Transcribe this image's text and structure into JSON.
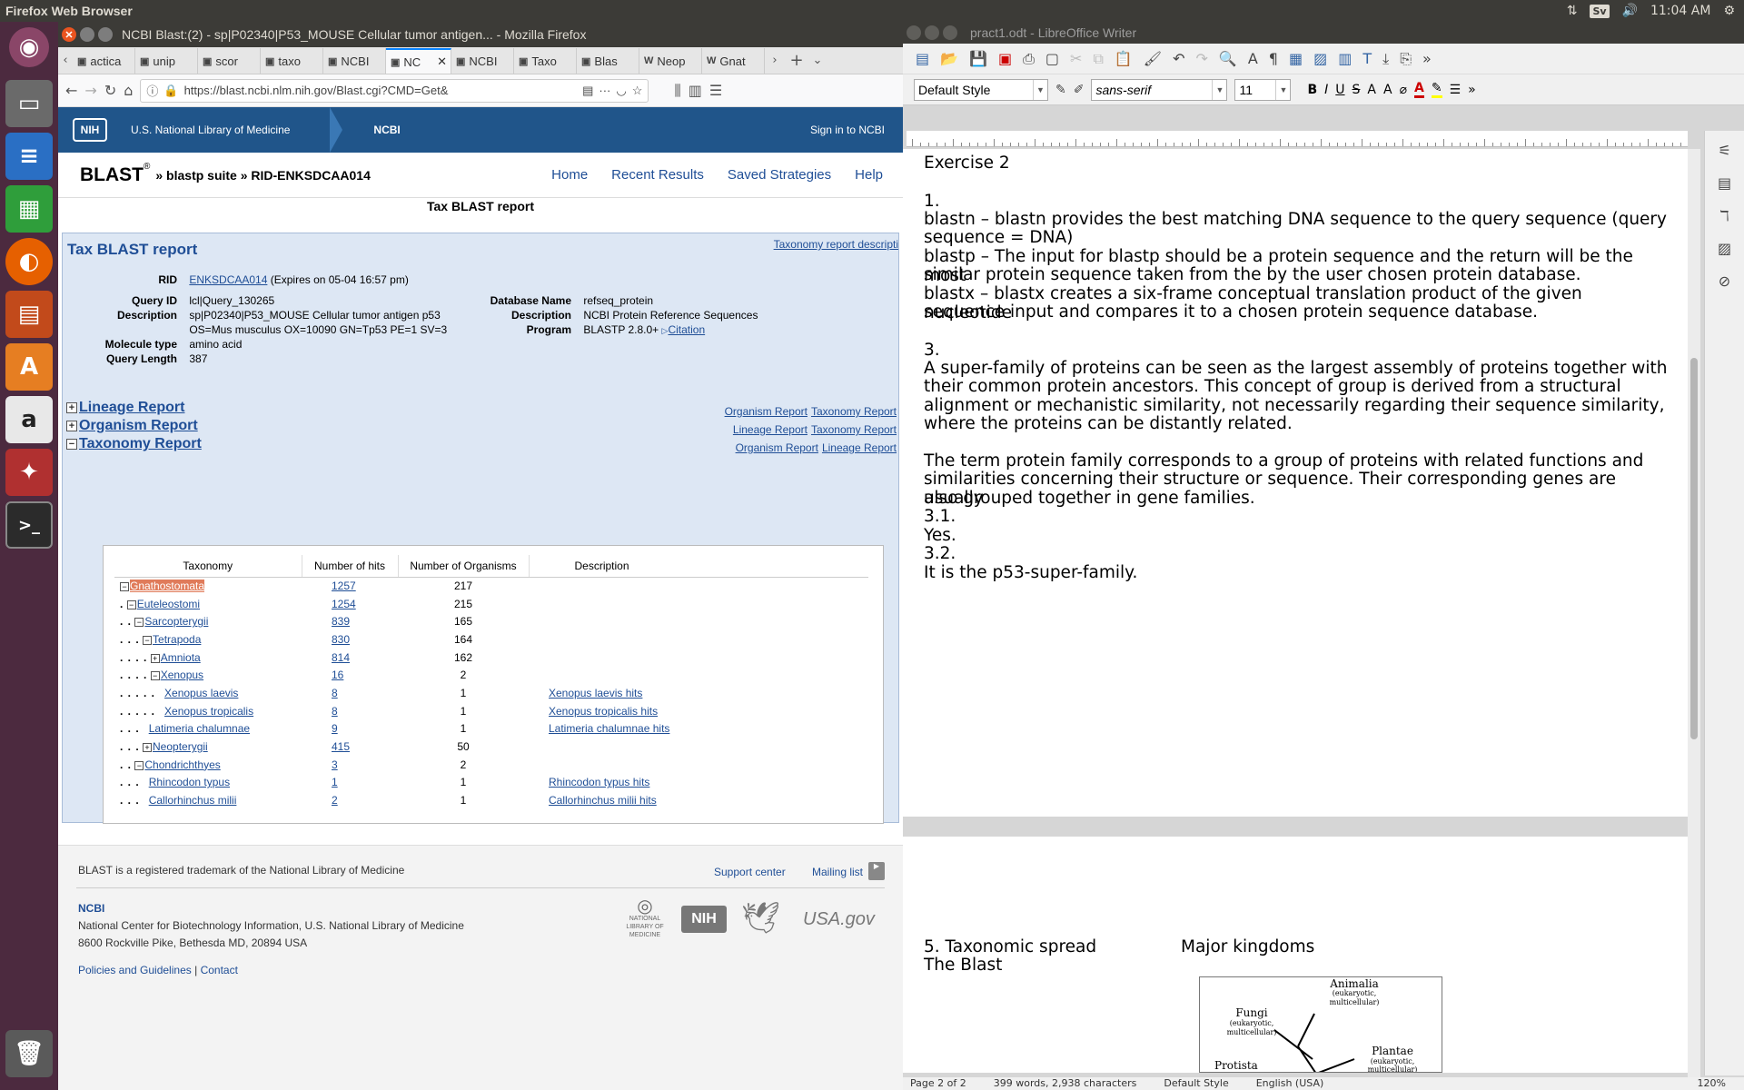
{
  "top_panel": {
    "app_name": "Firefox Web Browser",
    "keyboard": "Sv",
    "clock": "11:04 AM"
  },
  "launcher": {
    "items": [
      "ubuntu-dash-icon",
      "files-icon",
      "writer-icon",
      "calc-icon",
      "firefox-icon",
      "impress-icon",
      "software-center-icon",
      "amazon-icon",
      "settings-icon",
      "terminal-icon",
      "trash-icon"
    ]
  },
  "firefox": {
    "window_title": "NCBI Blast:(2) - sp|P02340|P53_MOUSE Cellular tumor antigen... - Mozilla Firefox",
    "tabs": [
      {
        "label": "actica",
        "fav": "",
        "active": false
      },
      {
        "label": "unip",
        "fav": "",
        "active": false
      },
      {
        "label": "scor",
        "fav": "",
        "active": false
      },
      {
        "label": "taxo",
        "fav": "",
        "active": false
      },
      {
        "label": "NCBI",
        "fav": "",
        "active": false
      },
      {
        "label": "NC",
        "fav": "",
        "active": true
      },
      {
        "label": "NCBI",
        "fav": "",
        "active": false
      },
      {
        "label": "Taxo",
        "fav": "",
        "active": false
      },
      {
        "label": "Blas",
        "fav": "",
        "active": false
      },
      {
        "label": "Neop",
        "fav": "W",
        "active": false
      },
      {
        "label": "Gnat",
        "fav": "W",
        "active": false
      }
    ],
    "url": "https://blast.ncbi.nlm.nih.gov/Blast.cgi?CMD=Get&",
    "nih_header": {
      "logo": "NIH",
      "library": "U.S. National Library of Medicine",
      "ncbi": "NCBI",
      "signin": "Sign in to NCBI"
    },
    "blast_header": {
      "logo": "BLAST",
      "reg": "®",
      "crumbs": "» blastp suite » RID-ENKSDCAA014",
      "nav": [
        "Home",
        "Recent Results",
        "Saved Strategies",
        "Help"
      ]
    },
    "page_heading": "Tax BLAST report",
    "report": {
      "title": "Tax BLAST report",
      "desc_link": "Taxonomy report descripti",
      "rid_label": "RID",
      "rid": "ENKSDCAA014",
      "rid_exp": "(Expires on 05-04 16:57 pm)",
      "query_id_label": "Query ID",
      "query_id": "lcl|Query_130265",
      "desc_label": "Description",
      "desc1": "sp|P02340|P53_MOUSE Cellular tumor antigen p53",
      "desc2": "OS=Mus musculus OX=10090 GN=Tp53 PE=1 SV=3",
      "mol_label": "Molecule type",
      "mol": "amino acid",
      "qlen_label": "Query Length",
      "qlen": "387",
      "db_label": "Database Name",
      "db": "refseq_protein",
      "dbdesc_label": "Description",
      "dbdesc": "NCBI Protein Reference Sequences",
      "prog_label": "Program",
      "prog": "BLASTP 2.8.0+",
      "citation": "Citation",
      "sections": [
        {
          "title": "Lineage Report",
          "box": "+",
          "links": [
            "Organism Report",
            "Taxonomy Report"
          ]
        },
        {
          "title": "Organism Report",
          "box": "+",
          "links": [
            "Lineage Report",
            "Taxonomy Report"
          ]
        },
        {
          "title": "Taxonomy Report",
          "box": "−",
          "links": [
            "Organism Report",
            "Lineage Report"
          ]
        }
      ],
      "table_headers": [
        "Taxonomy",
        "Number of hits",
        "Number of Organisms",
        "Description"
      ],
      "rows": [
        {
          "dots": "",
          "box": "−",
          "name": "Gnathostomata",
          "hits": "1257",
          "orgs": "217",
          "desc": ""
        },
        {
          "dots": ".",
          "box": "−",
          "name": "Euteleostomi",
          "hits": "1254",
          "orgs": "215",
          "desc": ""
        },
        {
          "dots": ". .",
          "box": "−",
          "name": "Sarcopterygii",
          "hits": "839",
          "orgs": "165",
          "desc": ""
        },
        {
          "dots": ". . .",
          "box": "−",
          "name": "Tetrapoda",
          "hits": "830",
          "orgs": "164",
          "desc": ""
        },
        {
          "dots": ". . . .",
          "box": "+",
          "name": "Amniota",
          "hits": "814",
          "orgs": "162",
          "desc": ""
        },
        {
          "dots": ". . . .",
          "box": "−",
          "name": "Xenopus",
          "hits": "16",
          "orgs": "2",
          "desc": ""
        },
        {
          "dots": ". . . . .",
          "box": "",
          "name": "Xenopus laevis",
          "hits": "8",
          "orgs": "1",
          "desc": "Xenopus laevis hits"
        },
        {
          "dots": ". . . . .",
          "box": "",
          "name": "Xenopus tropicalis",
          "hits": "8",
          "orgs": "1",
          "desc": "Xenopus tropicalis hits"
        },
        {
          "dots": ". . .",
          "box": "",
          "name": "Latimeria chalumnae",
          "hits": "9",
          "orgs": "1",
          "desc": "Latimeria chalumnae hits"
        },
        {
          "dots": ". . .",
          "box": "+",
          "name": "Neopterygii",
          "hits": "415",
          "orgs": "50",
          "desc": ""
        },
        {
          "dots": ". .",
          "box": "−",
          "name": "Chondrichthyes",
          "hits": "3",
          "orgs": "2",
          "desc": ""
        },
        {
          "dots": ". . .",
          "box": "",
          "name": "Rhincodon typus",
          "hits": "1",
          "orgs": "1",
          "desc": "Rhincodon typus hits"
        },
        {
          "dots": ". . .",
          "box": "",
          "name": "Callorhinchus milii",
          "hits": "2",
          "orgs": "1",
          "desc": "Callorhinchus milii hits"
        }
      ]
    },
    "footer": {
      "trademark": "BLAST is a registered trademark of the National Library of Medicine",
      "support": "Support center",
      "mailing": "Mailing list",
      "ncbi": "NCBI",
      "address1": "National Center for Biotechnology Information, U.S. National Library of Medicine",
      "address2": "8600 Rockville Pike, Bethesda MD, 20894 USA",
      "policies": "Policies and Guidelines",
      "sep": "|",
      "contact": "Contact",
      "logo_nlm1": "NATIONAL",
      "logo_nlm2": "LIBRARY OF",
      "logo_nlm3": "MEDICINE",
      "logo_nih": "NIH",
      "logo_usa": "USA.gov"
    }
  },
  "writer": {
    "window_title": "pract1.odt - LibreOffice Writer",
    "style": "Default Style",
    "font": "sans-serif",
    "size": "11",
    "doc": {
      "h": "Exercise 2",
      "n1": "1.",
      "p1a": "blastn – blastn provides the best matching DNA sequence to the query sequence (query",
      "p1b": "sequence = DNA)",
      "p2a": "blastp – The input for blastp should be a protein sequence and the return will be the most",
      "p2b": "similar protein sequence taken from the by the user chosen protein database.",
      "p3a": "blastx – blastx creates a six-frame conceptual translation product of the given nucleotide",
      "p3b": "sequence input and compares it to a chosen protein sequence database.",
      "n3": "3.",
      "p4a": "A super-family of proteins can be seen as the largest assembly of proteins together with",
      "p4b": "their common protein ancestors. This concept of group is derived from a structural",
      "p4c": "alignment or mechanistic similarity, not necessarily regarding their sequence similarity,",
      "p4d": "where the proteins can be distantly related.",
      "p5a": "The term protein family corresponds to a group of proteins with related functions and",
      "p5b": "similarities concerning their structure or sequence. Their corresponding genes are usually",
      "p5c": "also grouped together in gene families.",
      "n31": "3.1.",
      "yes": "Yes.",
      "n32": "3.2.",
      "p6": "It is the p53-super-family.",
      "page2_a": "5. Taxonomic spread",
      "page2_b": "The Blast",
      "page2_c": "Major kingdoms",
      "fig": {
        "animalia": "Animalia",
        "animalia_sub1": "(eukaryotic,",
        "animalia_sub2": "multicellular)",
        "fungi": "Fungi",
        "fungi_sub1": "(eukaryotic,",
        "fungi_sub2": "multicellular)",
        "plantae": "Plantae",
        "plantae_sub1": "(eukaryotic,",
        "plantae_sub2": "multicellular)",
        "protista": "Protista"
      }
    },
    "status": {
      "page": "Page 2 of 2",
      "words": "399 words, 2,938 characters",
      "style": "Default Style",
      "lang": "English (USA)",
      "zoom": "120%"
    }
  }
}
